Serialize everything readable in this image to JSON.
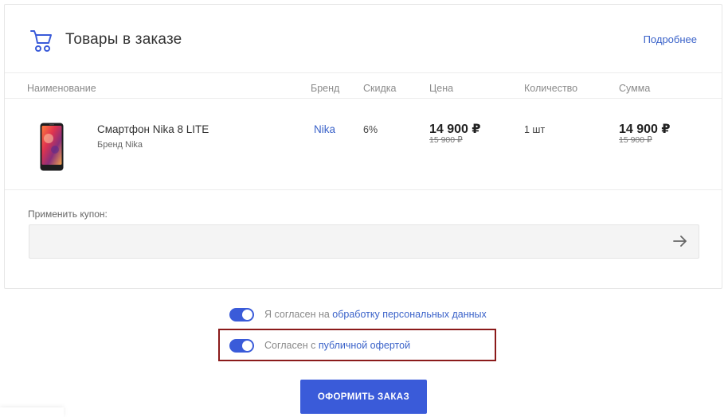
{
  "header": {
    "title": "Товары в заказе",
    "more_link": "Подробнее",
    "icon": "cart-icon"
  },
  "table": {
    "columns": [
      "Наименование",
      "Бренд",
      "Скидка",
      "Цена",
      "Количество",
      "Сумма"
    ],
    "items": [
      {
        "name": "Смартфон Nika 8 LITE",
        "brand_line": "Бренд  Nika",
        "brand": "Nika",
        "discount": "6%",
        "price": "14 900 ₽",
        "old_price": "15 900 ₽",
        "quantity": "1 шт",
        "sum": "14 900 ₽",
        "old_sum": "15 900 ₽"
      }
    ]
  },
  "coupon": {
    "label": "Применить купон:",
    "value": "",
    "icon": "arrow-right-icon"
  },
  "consents": [
    {
      "prefix": "Я согласен на ",
      "link": "обработку персональных данных",
      "checked": true
    },
    {
      "prefix": "Согласен с ",
      "link": "публичной офертой",
      "checked": true
    }
  ],
  "checkout": {
    "label": "ОФОРМИТЬ ЗАКАЗ"
  },
  "colors": {
    "accent": "#3a5bd9",
    "link": "#3a62c9",
    "highlight": "#8b1a1a"
  }
}
